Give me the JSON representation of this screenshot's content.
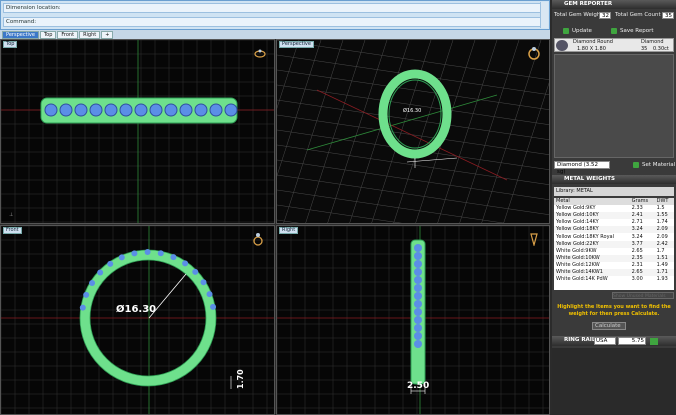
{
  "command": {
    "row1": "Dimension location:",
    "row2": "Command:"
  },
  "tabs": [
    "Perspective",
    "Top",
    "Front",
    "Right",
    "+"
  ],
  "viewports": {
    "top": {
      "label": "Top"
    },
    "perspective": {
      "label": "Perspective",
      "dim": "Ø16.30"
    },
    "front": {
      "label": "Front",
      "diameter": "Ø16.30",
      "height": "1.70"
    },
    "right": {
      "label": "Right",
      "width": "2.50"
    }
  },
  "gem_reporter": {
    "title": "GEM REPORTER",
    "total_weight_label": "Total Gem Weight",
    "total_weight": "32",
    "total_count_label": "Total Gem Count",
    "total_count": "35",
    "update": "Update",
    "save_report": "Save Report",
    "gem": {
      "name": "Diamond Round",
      "size": "1.80 X 1.80",
      "type": "Diamond",
      "count": "35",
      "weight": "0.30ct"
    },
    "material_select": "Diamond  (3.52 sg)",
    "set_material": "Set Material"
  },
  "metal_weights": {
    "title": "METAL WEIGHTS",
    "library_label": "Library:",
    "library": "METAL",
    "columns": [
      "Metal",
      "Grams",
      "DWT"
    ],
    "rows": [
      [
        "Yellow Gold:9KY",
        "2.33",
        "1.5"
      ],
      [
        "Yellow Gold:10KY",
        "2.41",
        "1.55"
      ],
      [
        "Yellow Gold:14KY",
        "2.71",
        "1.74"
      ],
      [
        "Yellow Gold:18KY",
        "3.24",
        "2.09"
      ],
      [
        "Yellow Gold:18KY Royal",
        "3.24",
        "2.09"
      ],
      [
        "Yellow Gold:22KY",
        "3.77",
        "2.42"
      ],
      [
        "White Gold:9KW",
        "2.65",
        "1.7"
      ],
      [
        "White Gold:10KW",
        "2.35",
        "1.51"
      ],
      [
        "White Gold:12KW",
        "2.31",
        "1.49"
      ],
      [
        "White Gold:14KW1",
        "2.65",
        "1.71"
      ],
      [
        "White Gold:14K PdW",
        "3.00",
        "1.93"
      ]
    ],
    "hint": "Highlight the Items you want to find the weight for then press Calculate.",
    "calculate": "Calculate",
    "show_unused": "Show Unused Materials"
  },
  "ring_rail": {
    "title": "RING RAIL",
    "region": "USA",
    "size": "5.75"
  },
  "colors": {
    "ring": "#6ee08c",
    "gem": "#5b8ee6",
    "grid": "#3a3a3a",
    "axis_red": "#b0222a",
    "axis_green": "#2e8a3a"
  }
}
